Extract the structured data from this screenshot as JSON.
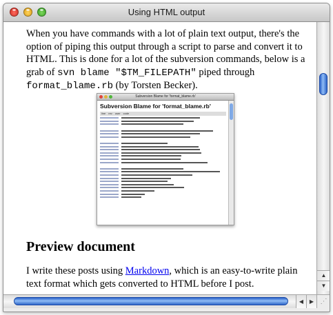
{
  "window": {
    "title": "Using HTML output"
  },
  "article": {
    "para1": {
      "t1": "When you have commands with a lot of plain text output, there's the option of piping this output through a script to parse and convert it to HTML. This is done for a lot of the subversion commands, below is a grab of ",
      "code1": "svn blame \"$TM_FILEPATH\"",
      "t2": " piped through ",
      "code2": "format_blame.rb",
      "t3": " (by Torsten Becker)."
    },
    "screenshot": {
      "window_title": "Subversion Blame for 'format_blame.rb'",
      "heading": "Subversion Blame for 'format_blame.rb'",
      "columns": [
        "line",
        "rev",
        "user",
        "code"
      ]
    },
    "heading": "Preview document",
    "para2": {
      "t1": "I write these posts using ",
      "link": "Markdown",
      "t2": ", which is an easy-to-write plain text format which gets converted to HTML before I post."
    }
  },
  "scrollbars": {
    "up_arrow": "▲",
    "down_arrow": "▼",
    "left_arrow": "◀",
    "right_arrow": "▶",
    "grow_glyph": "⋰"
  },
  "colors": {
    "link": "#0000ee",
    "thumb": "#3a74d6"
  }
}
